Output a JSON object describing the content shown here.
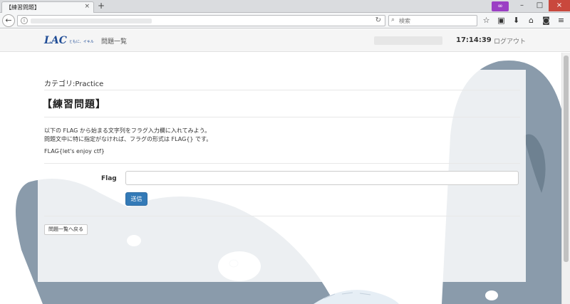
{
  "browser": {
    "tab_title": "【練習問題】",
    "tab_close": "×",
    "new_tab": "+",
    "mask_glyph": "∞",
    "minimize": "–",
    "maximize": "□",
    "close": "×",
    "back_glyph": "←",
    "info_glyph": "i",
    "reload_glyph": "↻",
    "search_glyph": "⌕",
    "search_placeholder": "検索",
    "tool_glyphs": {
      "bookmark": "☆",
      "library": "▣",
      "download": "⬇",
      "home": "⌂",
      "pocket": "◙",
      "menu": "≡"
    }
  },
  "site": {
    "logo_text": "LAC",
    "logo_tagline": "ともに、イキル",
    "nav_link": "問題一覧",
    "clock": "17:14:39",
    "logout": "ログアウト",
    "brand_color": "#1f4c96"
  },
  "problem": {
    "category": "カテゴリ:Practice",
    "title": "【練習問題】",
    "description_line1": "以下の FLAG から始まる文字列をフラグ入力欄に入れてみよう。",
    "description_line2": "問題文中に特に指定がなければ、フラグの形式は FLAG{} です。",
    "description_line3": "FLAG{let's enjoy ctf}",
    "flag_label": "Flag",
    "flag_value": "",
    "submit_label": "送信",
    "back_label": "問題一覧へ戻る",
    "accent_color": "#337ab7"
  }
}
